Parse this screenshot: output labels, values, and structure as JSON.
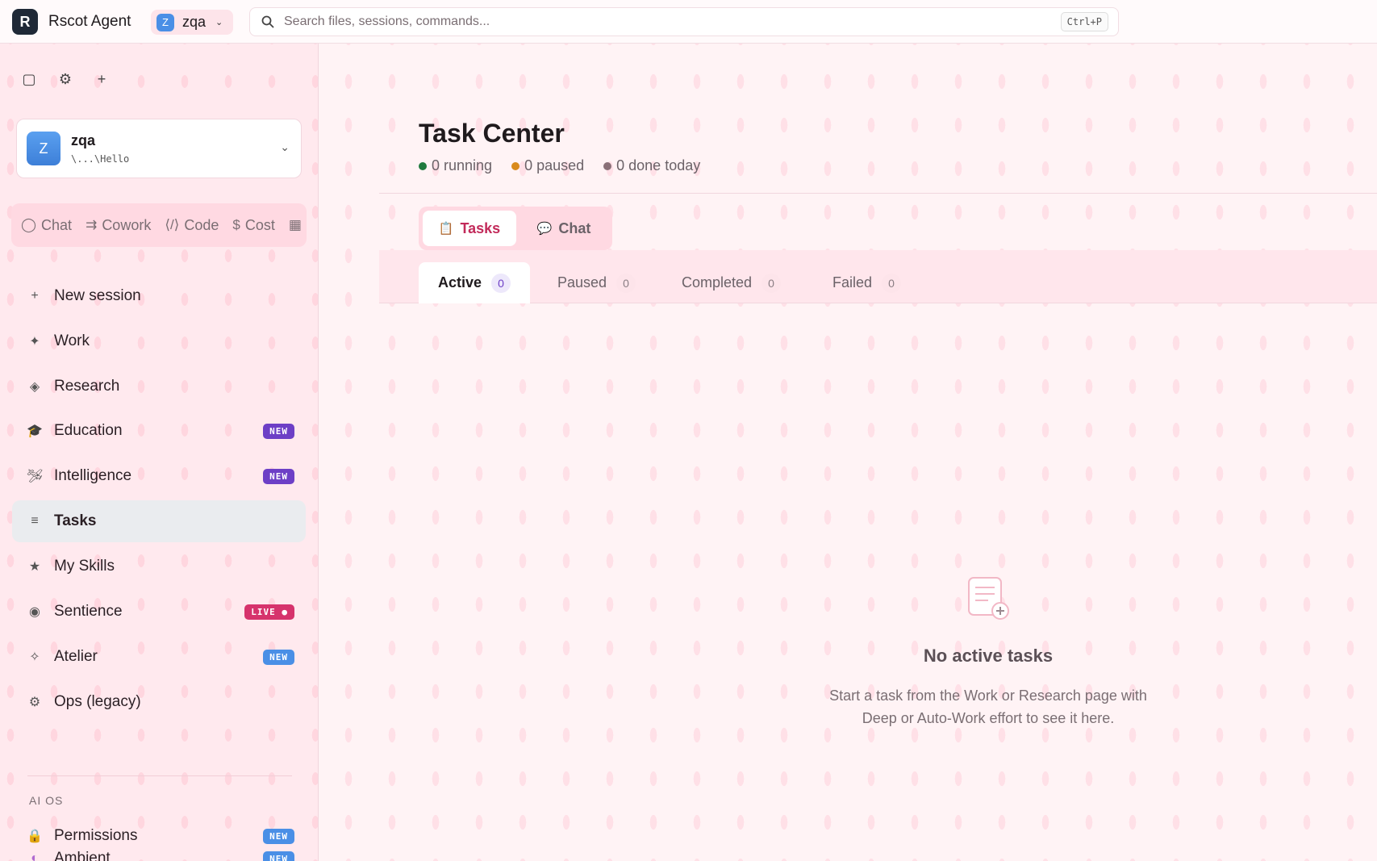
{
  "app": {
    "logo_letter": "R",
    "title": "Rscot Agent",
    "workspace_pill": {
      "avatar": "Z",
      "name": "zqa",
      "chevron_icon": "chevron-down-icon"
    }
  },
  "search": {
    "placeholder": "Search files, sessions, commands...",
    "value": "",
    "shortcut": "Ctrl+P",
    "icon": "search-icon"
  },
  "sidebar": {
    "tools": [
      {
        "name": "sidebar-toggle",
        "icon": "square-icon",
        "glyph": "▢"
      },
      {
        "name": "settings",
        "icon": "gear-icon",
        "glyph": "⚙"
      },
      {
        "name": "add",
        "icon": "plus-icon",
        "glyph": "+"
      }
    ],
    "workspace": {
      "avatar": "Z",
      "name": "zqa",
      "path": "\\...\\Hello"
    },
    "modes": [
      {
        "label": "Chat",
        "glyph": "◯",
        "icon": "circle-icon"
      },
      {
        "label": "Cowork",
        "glyph": "⇉",
        "icon": "arrows-icon"
      },
      {
        "label": "Code",
        "glyph": "⟨/⟩",
        "icon": "code-icon"
      },
      {
        "label": "Cost",
        "glyph": "$",
        "icon": "dollar-icon"
      },
      {
        "label": "",
        "glyph": "▦",
        "icon": "grid-icon"
      }
    ],
    "items": [
      {
        "label": "New session",
        "glyph": "+",
        "icon": "plus-icon",
        "badge": ""
      },
      {
        "label": "Work",
        "glyph": "✦",
        "icon": "sparkle-icon",
        "badge": ""
      },
      {
        "label": "Research",
        "glyph": "◈",
        "icon": "diamond-icon",
        "badge": ""
      },
      {
        "label": "Education",
        "glyph": "🎓",
        "icon": "graduation-cap-icon",
        "badge": "NEW"
      },
      {
        "label": "Intelligence",
        "glyph": "🛩",
        "icon": "plane-icon",
        "badge": "NEW"
      },
      {
        "label": "Tasks",
        "glyph": "≡",
        "icon": "list-icon",
        "badge": "",
        "active": true
      },
      {
        "label": "My Skills",
        "glyph": "★",
        "icon": "star-icon",
        "badge": ""
      },
      {
        "label": "Sentience",
        "glyph": "◉",
        "icon": "radio-icon",
        "badge": "LIVE ●"
      },
      {
        "label": "Atelier",
        "glyph": "✧",
        "icon": "sparkle-outline-icon",
        "badge": "NEW"
      },
      {
        "label": "Ops (legacy)",
        "glyph": "⚙",
        "icon": "gear-icon",
        "badge": ""
      }
    ],
    "section_label": "AI OS",
    "section_items": [
      {
        "label": "Permissions",
        "glyph": "🔒",
        "icon": "lock-icon",
        "badge": "NEW"
      },
      {
        "label": "Ambient",
        "glyph": "◐",
        "icon": "ambient-icon",
        "badge": "NEW"
      }
    ]
  },
  "main": {
    "title": "Task Center",
    "stats": [
      {
        "text": "0 running",
        "color": "#1f7a3e"
      },
      {
        "text": "0 paused",
        "color": "#d98a1c"
      },
      {
        "text": "0 done today",
        "color": "#8a7078"
      }
    ],
    "segments": [
      {
        "label": "Tasks",
        "icon": "clipboard-icon",
        "glyph": "📋"
      },
      {
        "label": "Chat",
        "icon": "speech-bubble-icon",
        "glyph": "💬"
      }
    ],
    "tabs": [
      {
        "label": "Active",
        "count": "0"
      },
      {
        "label": "Paused",
        "count": "0"
      },
      {
        "label": "Completed",
        "count": "0"
      },
      {
        "label": "Failed",
        "count": "0"
      }
    ],
    "empty": {
      "icon": "new-document-icon",
      "title": "No active tasks",
      "line1": "Start a task from the Work or Research page with",
      "line2": "Deep or Auto-Work effort to see it here."
    }
  },
  "colors": {
    "accent": "#c22a5a",
    "badge_purple": "#6d3fc6",
    "badge_blue": "#4a8fe6",
    "badge_red": "#d6336c"
  }
}
